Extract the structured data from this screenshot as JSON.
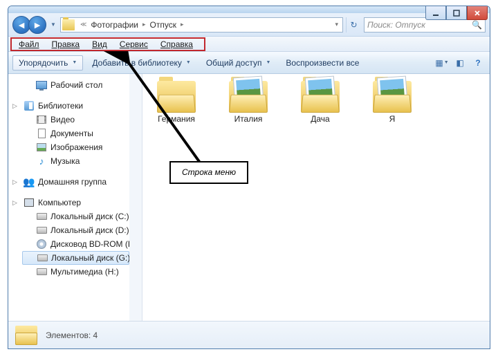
{
  "breadcrumb": {
    "seg1": "Фотографии",
    "seg2": "Отпуск"
  },
  "search": {
    "placeholder": "Поиск: Отпуск"
  },
  "menubar": {
    "file": "Файл",
    "edit": "Правка",
    "view": "Вид",
    "tools": "Сервис",
    "help": "Справка"
  },
  "toolbar": {
    "organize": "Упорядочить",
    "addlib": "Добавить в библиотеку",
    "share": "Общий доступ",
    "play": "Воспроизвести все"
  },
  "sidebar": {
    "desktop": "Рабочий стол",
    "libraries": "Библиотеки",
    "videos": "Видео",
    "documents": "Документы",
    "pictures": "Изображения",
    "music": "Музыка",
    "homegroup": "Домашняя группа",
    "computer": "Компьютер",
    "drive_c": "Локальный диск (C:)",
    "drive_d": "Локальный диск (D:)",
    "drive_f": "Дисковод BD-ROM (F:)",
    "drive_g": "Локальный диск (G:)",
    "drive_h": "Мультимедиа (H:)"
  },
  "files": [
    {
      "name": "Германия",
      "thumb": false
    },
    {
      "name": "Италия",
      "thumb": true
    },
    {
      "name": "Дача",
      "thumb": true
    },
    {
      "name": "Я",
      "thumb": true
    }
  ],
  "status": {
    "label": "Элементов: 4"
  },
  "callout": {
    "text": "Строка меню"
  }
}
